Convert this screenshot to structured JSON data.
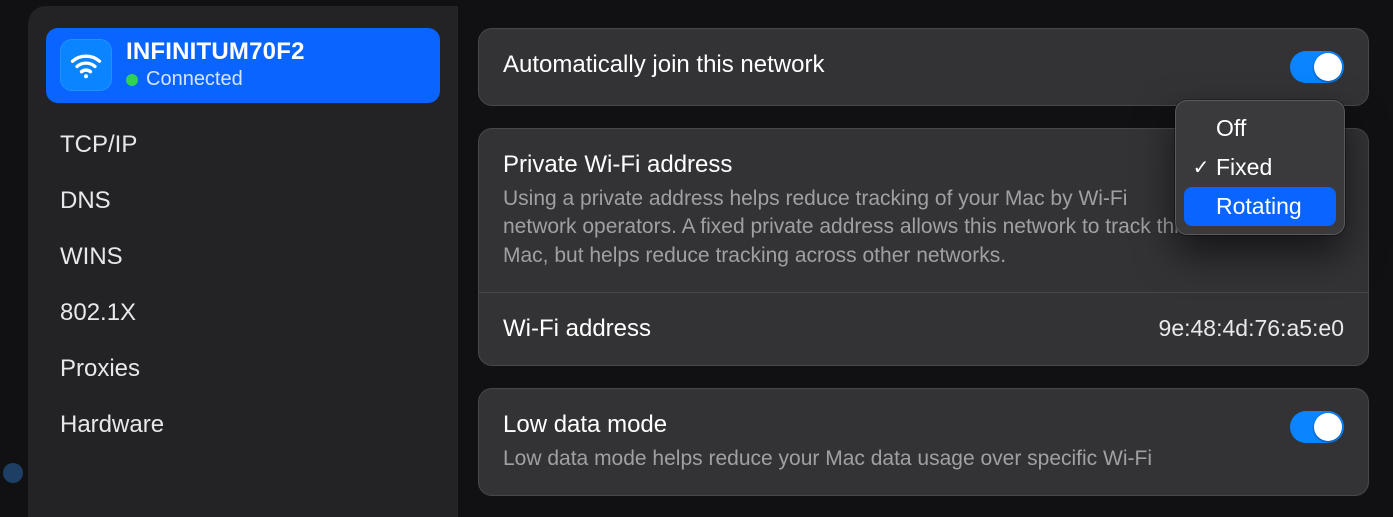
{
  "sidebar": {
    "network": {
      "name": "INFINITUM70F2",
      "status": "Connected"
    },
    "items": [
      "TCP/IP",
      "DNS",
      "WINS",
      "802.1X",
      "Proxies",
      "Hardware"
    ]
  },
  "main": {
    "auto_join": {
      "title": "Automatically join this network",
      "on": true
    },
    "private_addr": {
      "title": "Private Wi-Fi address",
      "desc": "Using a private address helps reduce tracking of your Mac by Wi-Fi network operators. A fixed private address allows this network to track this Mac, but helps reduce tracking across other networks.",
      "wifi_addr_label": "Wi-Fi address",
      "wifi_addr_value": "9e:48:4d:76:a5:e0",
      "menu": {
        "options": [
          "Off",
          "Fixed",
          "Rotating"
        ],
        "checked": "Fixed",
        "highlighted": "Rotating"
      }
    },
    "low_data": {
      "title": "Low data mode",
      "desc": "Low data mode helps reduce your Mac data usage over specific Wi-Fi",
      "on": true
    }
  }
}
